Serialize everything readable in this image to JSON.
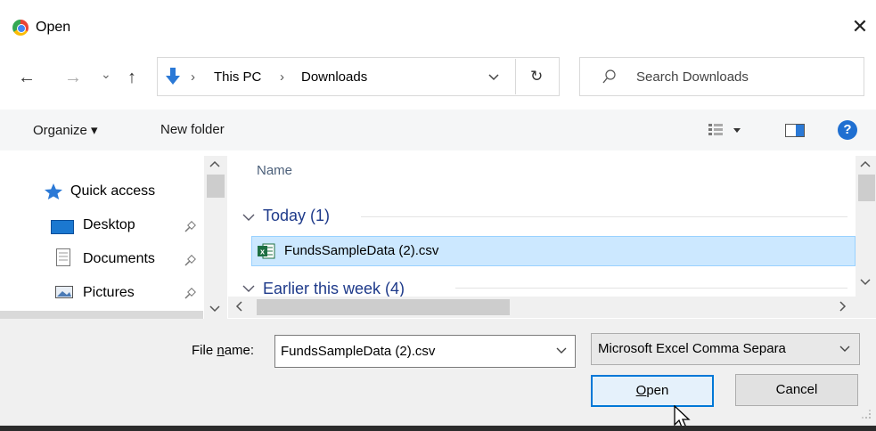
{
  "window": {
    "title": "Open",
    "close_label": "✕"
  },
  "nav": {
    "back_icon": "←",
    "forward_icon": "→",
    "recent_icon": "⌄",
    "up_icon": "↑",
    "breadcrumb": [
      "This PC",
      "Downloads"
    ],
    "separator": "›",
    "refresh_icon": "↻"
  },
  "search": {
    "placeholder": "Search Downloads"
  },
  "toolbar": {
    "organize": "Organize ▾",
    "new_folder": "New folder",
    "help": "?"
  },
  "sidebar": {
    "items": [
      {
        "label": "Quick access"
      },
      {
        "label": "Desktop"
      },
      {
        "label": "Documents"
      },
      {
        "label": "Pictures"
      }
    ]
  },
  "file_list": {
    "column_name": "Name",
    "groups": [
      {
        "label": "Today (1)"
      },
      {
        "label": "Earlier this week (4)"
      }
    ],
    "files": [
      {
        "name": "FundsSampleData (2).csv",
        "selected": true
      }
    ]
  },
  "footer": {
    "file_name_label_pre": "File ",
    "file_name_label_ul": "n",
    "file_name_label_post": "ame:",
    "file_name_value": "FundsSampleData (2).csv",
    "file_type_value": "Microsoft Excel Comma Separa",
    "open_ul": "O",
    "open_rest": "pen",
    "cancel": "Cancel"
  },
  "colors": {
    "accent": "#0078d7",
    "selection": "#cce8ff",
    "group_text": "#1e3a8a"
  }
}
